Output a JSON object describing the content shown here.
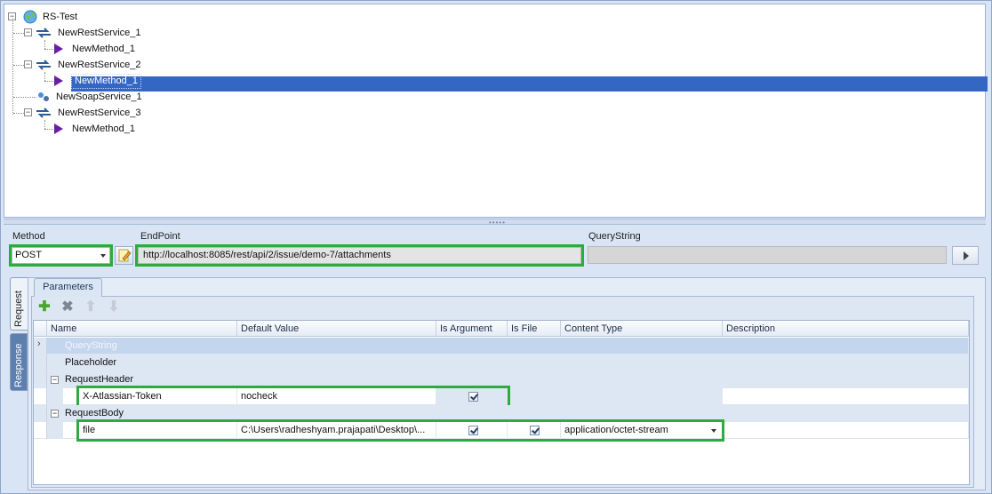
{
  "tree": {
    "root": "RS-Test",
    "nodes": [
      {
        "label": "NewRestService_1"
      },
      {
        "label": "NewMethod_1"
      },
      {
        "label": "NewRestService_2"
      },
      {
        "label": "NewMethod_1"
      },
      {
        "label": "NewSoapService_1"
      },
      {
        "label": "NewRestService_3"
      },
      {
        "label": "NewMethod_1"
      }
    ],
    "selected_index": 3
  },
  "form": {
    "method_label": "Method",
    "method_value": "POST",
    "endpoint_label": "EndPoint",
    "endpoint_value": "http://localhost:8085/rest/api/2/issue/demo-7/attachments",
    "querystring_label": "QueryString",
    "querystring_value": ""
  },
  "side_tabs": {
    "request": "Request",
    "response": "Response"
  },
  "params": {
    "tab_label": "Parameters",
    "toolbar": [
      "add-icon",
      "delete-icon",
      "move-up-icon",
      "move-down-icon"
    ],
    "columns": [
      "Name",
      "Default Value",
      "Is Argument",
      "Is File",
      "Content Type",
      "Description"
    ],
    "rows": [
      {
        "name": "QueryString"
      },
      {
        "name": "Placeholder"
      },
      {
        "name": "RequestHeader"
      },
      {
        "name": "X-Atlassian-Token",
        "default": "nocheck",
        "is_argument": true
      },
      {
        "name": "RequestBody"
      },
      {
        "name": "file",
        "default": "C:\\Users\\radheshyam.prajapati\\Desktop\\...",
        "is_argument": true,
        "is_file": true,
        "content_type": "application/octet-stream"
      }
    ]
  },
  "colors": {
    "selection": "#3467c4",
    "highlight_box": "#2faa3f",
    "panel_bg": "#d9e5f5"
  }
}
